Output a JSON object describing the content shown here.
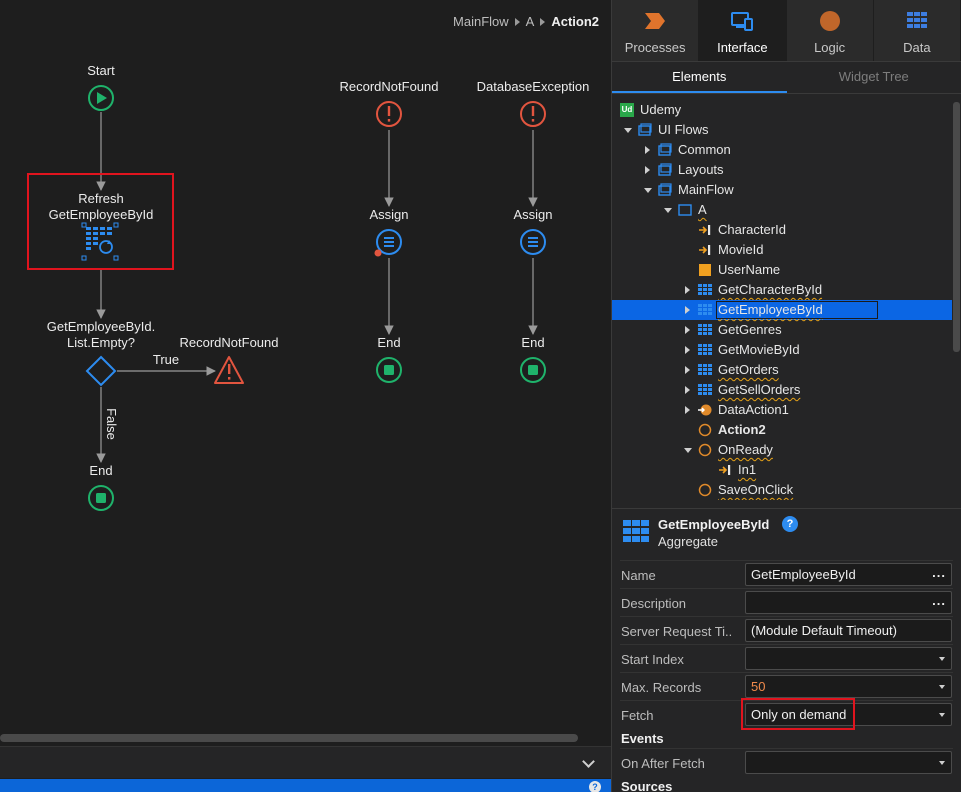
{
  "breadcrumb": {
    "items": [
      "MainFlow",
      "A"
    ],
    "current": "Action2"
  },
  "flow": {
    "start_label": "Start",
    "refresh_label_line1": "Refresh",
    "refresh_label_line2": "GetEmployeeById",
    "if_label_line1": "GetEmployeeById.",
    "if_label_line2": "List.Empty?",
    "true_label": "True",
    "false_label": "False",
    "raise_label": "RecordNotFound",
    "end_label": "End",
    "handlers": [
      {
        "name": "RecordNotFound",
        "assign": "Assign",
        "end": "End"
      },
      {
        "name": "DatabaseException",
        "assign": "Assign",
        "end": "End"
      }
    ]
  },
  "panel": {
    "tabs": [
      {
        "label": "Processes",
        "icon": "processes-icon"
      },
      {
        "label": "Interface",
        "icon": "interface-icon",
        "active": true
      },
      {
        "label": "Logic",
        "icon": "logic-icon"
      },
      {
        "label": "Data",
        "icon": "data-icon"
      }
    ],
    "subtabs": [
      "Elements",
      "Widget Tree"
    ],
    "tree": [
      {
        "label": "Udemy",
        "icon": "module-icon",
        "level": 0,
        "toggle": "none",
        "badge": "Ud"
      },
      {
        "label": "UI Flows",
        "icon": "flows-icon",
        "level": 1,
        "toggle": "open"
      },
      {
        "label": "Common",
        "icon": "flow-icon",
        "level": 2,
        "toggle": "closed"
      },
      {
        "label": "Layouts",
        "icon": "flow-icon",
        "level": 2,
        "toggle": "closed"
      },
      {
        "label": "MainFlow",
        "icon": "flow-icon",
        "level": 2,
        "toggle": "open"
      },
      {
        "label": "A",
        "icon": "screen-icon",
        "level": 3,
        "toggle": "open",
        "warn": true
      },
      {
        "label": "CharacterId",
        "icon": "input-param-icon",
        "level": 4,
        "toggle": "none"
      },
      {
        "label": "MovieId",
        "icon": "input-param-icon",
        "level": 4,
        "toggle": "none"
      },
      {
        "label": "UserName",
        "icon": "local-var-icon",
        "level": 4,
        "toggle": "none"
      },
      {
        "label": "GetCharacterById",
        "icon": "aggregate-icon",
        "level": 4,
        "toggle": "closed",
        "warn": true
      },
      {
        "label": "GetEmployeeById",
        "icon": "aggregate-icon",
        "level": 4,
        "toggle": "closed",
        "warn": true,
        "selected": true
      },
      {
        "label": "GetGenres",
        "icon": "aggregate-icon",
        "level": 4,
        "toggle": "closed"
      },
      {
        "label": "GetMovieById",
        "icon": "aggregate-icon",
        "level": 4,
        "toggle": "closed"
      },
      {
        "label": "GetOrders",
        "icon": "aggregate-icon",
        "level": 4,
        "toggle": "closed",
        "warn": true
      },
      {
        "label": "GetSellOrders",
        "icon": "aggregate-icon",
        "level": 4,
        "toggle": "closed",
        "warn": true
      },
      {
        "label": "DataAction1",
        "icon": "data-action-icon",
        "level": 4,
        "toggle": "closed"
      },
      {
        "label": "Action2",
        "icon": "action-icon",
        "level": 4,
        "toggle": "none",
        "bold": true
      },
      {
        "label": "OnReady",
        "icon": "action-icon",
        "level": 4,
        "toggle": "open",
        "warn": true
      },
      {
        "label": "In1",
        "icon": "input-param-icon",
        "level": 5,
        "toggle": "none",
        "warn": true
      },
      {
        "label": "SaveOnClick",
        "icon": "action-icon",
        "level": 4,
        "toggle": "none",
        "warn": true
      }
    ],
    "properties": {
      "title": "GetEmployeeById",
      "subtitle": "Aggregate",
      "rows": [
        {
          "label": "Name",
          "value": "GetEmployeeById",
          "control": "dots"
        },
        {
          "label": "Description",
          "value": "",
          "control": "dots"
        },
        {
          "label": "Server Request Ti...",
          "value": "(Module Default Timeout)",
          "control": "none"
        },
        {
          "label": "Start Index",
          "value": "",
          "control": "dropdown"
        },
        {
          "label": "Max. Records",
          "value": "50",
          "control": "dropdown",
          "numeric": true
        },
        {
          "label": "Fetch",
          "value": "Only on demand",
          "control": "dropdown"
        }
      ],
      "events_header": "Events",
      "events": [
        {
          "label": "On After Fetch",
          "value": "",
          "control": "dropdown"
        }
      ],
      "sources_header": "Sources"
    }
  },
  "colors": {
    "accent_blue": "#2d8cf0",
    "start_green": "#1fb36b",
    "error_red": "#e2553f",
    "highlight_red": "#e0141e",
    "selection_blue": "#0b66e4"
  }
}
